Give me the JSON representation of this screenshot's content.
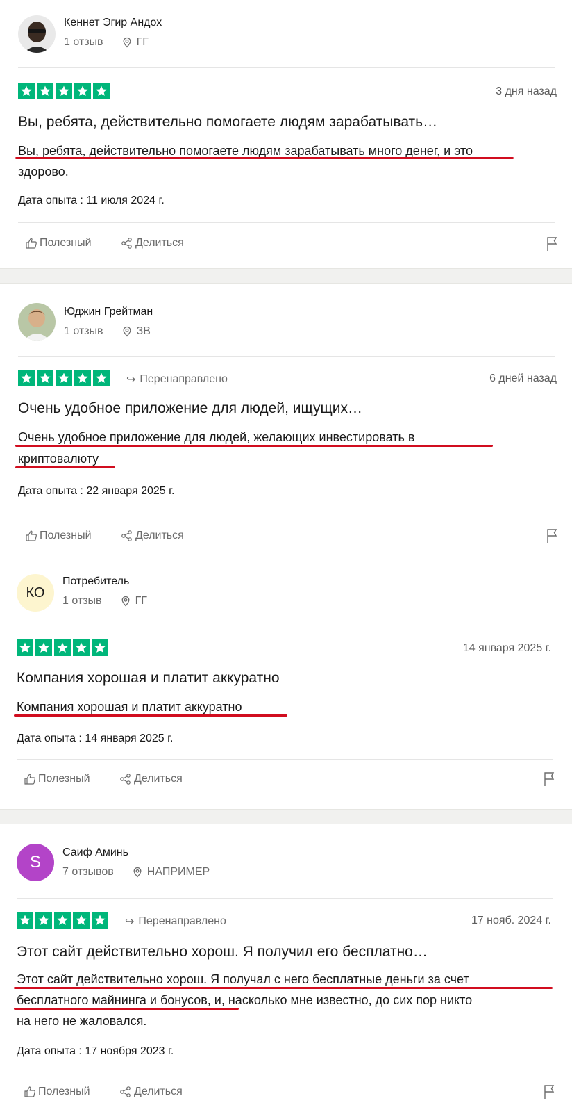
{
  "reviews": [
    {
      "name": "Кеннет Эгир Андох",
      "reviews_count": "1 отзыв",
      "country": "ГГ",
      "avatar_initials": "",
      "redirect": "",
      "date": "3 дня назад",
      "title": "Вы, ребята, действительно помогаете людям зарабатывать…",
      "body_lines": [
        "Вы, ребята, действительно помогаете людям зарабатывать много денег, и это",
        "здорово."
      ],
      "experience": "Дата опыта : 11 июля 2024 г.",
      "rating": 5
    },
    {
      "name": "Юджин Грейтман",
      "reviews_count": "1 отзыв",
      "country": "ЗВ",
      "avatar_initials": "",
      "redirect": "Перенаправлено",
      "date": "6 дней назад",
      "title": "Очень удобное приложение для людей, ищущих…",
      "body_lines": [
        "Очень удобное приложение для людей, желающих инвестировать в",
        "криптовалюту"
      ],
      "experience": "Дата опыта : 22 января 2025 г.",
      "rating": 5
    },
    {
      "name": "Потребитель",
      "reviews_count": "1 отзыв",
      "country": "ГГ",
      "avatar_initials": "КО",
      "redirect": "",
      "date": "14 января 2025 г.",
      "title": "Компания хорошая и платит аккуратно",
      "body_lines": [
        "Компания хорошая и платит аккуратно"
      ],
      "experience": "Дата опыта : 14 января 2025 г.",
      "rating": 5
    },
    {
      "name": "Саиф Аминь",
      "reviews_count": "7 отзывов",
      "country": "НАПРИМЕР",
      "avatar_initials": "S",
      "redirect": "Перенаправлено",
      "date": "17 нояб. 2024 г.",
      "title": "Этот сайт действительно хорош. Я получил его бесплатно…",
      "body_lines": [
        "Этот сайт действительно хорош. Я получал с него бесплатные деньги за счет",
        "бесплатного майнинга и бонусов, и, насколько мне известно, до сих пор никто",
        "на него не жаловался."
      ],
      "experience": "Дата опыта : 17 ноября 2023 г.",
      "rating": 5
    }
  ],
  "actions": {
    "helpful": "Полезный",
    "share": "Делиться"
  },
  "colors": {
    "star_green": "#00b67a",
    "highlight_red": "#d10d1f",
    "purple_avatar": "#b344c8",
    "yellow_avatar": "#fdf5cf"
  }
}
